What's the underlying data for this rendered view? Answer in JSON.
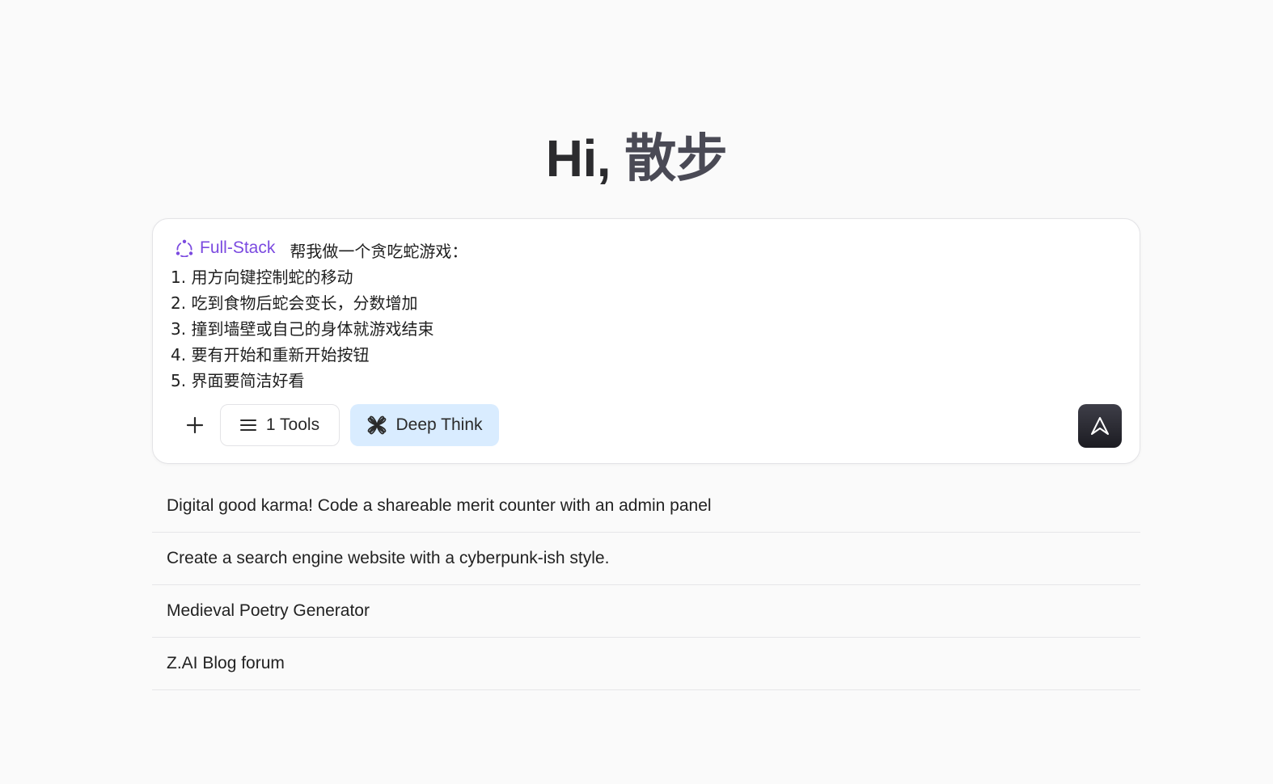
{
  "greeting": {
    "hi": "Hi,",
    "name": "散步"
  },
  "composer": {
    "mode_tag": "Full-Stack",
    "prompt_lines": [
      "帮我做一个贪吃蛇游戏：",
      "1. 用方向键控制蛇的移动",
      "2. 吃到食物后蛇会变长，分数增加",
      "3. 撞到墙壁或自己的身体就游戏结束",
      "4. 要有开始和重新开始按钮",
      "5. 界面要简洁好看"
    ],
    "add_label": "+",
    "tools_label": "1 Tools",
    "deep_think_label": "Deep Think"
  },
  "suggestions": [
    "Digital good karma! Code a shareable merit counter with an admin panel",
    "Create a search engine website with a cyberpunk-ish style.",
    "Medieval Poetry Generator",
    "Z.AI Blog forum"
  ],
  "colors": {
    "accent_purple": "#7b4ae0",
    "deep_think_bg": "#d9ecff",
    "send_button_bg": "#25252c",
    "page_bg": "#fafafa"
  },
  "icons": {
    "mode": "full-stack-icon",
    "add": "plus-icon",
    "tools": "menu-icon",
    "deep_think": "deep-think-icon",
    "send": "send-arrow-icon"
  }
}
